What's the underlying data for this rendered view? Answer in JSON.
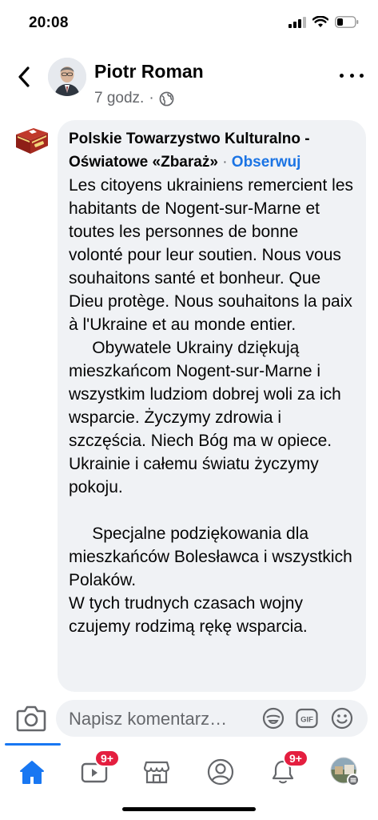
{
  "status_bar": {
    "time": "20:08"
  },
  "post": {
    "author": "Piotr Roman",
    "time": "7 godz.",
    "separator": "·"
  },
  "comment": {
    "author": "Polskie Towarzystwo Kulturalno - Oświatowe «Zbaraż»",
    "separator": "·",
    "follow_label": "Obserwuj",
    "text": "Les citoyens ukrainiens remercient les habitants de Nogent-sur-Marne et toutes les personnes de bonne volonté pour leur soutien. Nous vous souhaitons santé et bonheur. Que Dieu protège. Nous souhaitons la paix à l'Ukraine et au monde entier.\n     Obywatele Ukrainy dziękują mieszkańcom Nogent-sur-Marne i wszystkim ludziom dobrej woli za ich wsparcie. Życzymy zdrowia i szczęścia. Niech Bóg ma w opiece. Ukrainie i całemu światu życzymy pokoju.\n\n     Specjalne podziękowania dla mieszkańców Bolesławca i wszystkich Polaków.\nW tych trudnych czasach wojny czujemy rodzimą rękę wsparcia."
  },
  "composer": {
    "placeholder": "Napisz komentarz…",
    "icons": [
      "camera-icon",
      "sticker-icon",
      "gif-icon",
      "emoji-icon"
    ]
  },
  "tabbar": {
    "tabs": [
      {
        "name": "home",
        "active": true
      },
      {
        "name": "video",
        "badge": "9+"
      },
      {
        "name": "marketplace"
      },
      {
        "name": "profile"
      },
      {
        "name": "notifications",
        "badge": "9+"
      },
      {
        "name": "menu"
      }
    ]
  },
  "colors": {
    "accent": "#1877f2",
    "link": "#1b74e4",
    "bubble": "#f0f2f5",
    "secondary_text": "#65676b",
    "badge": "#e41e3f"
  }
}
